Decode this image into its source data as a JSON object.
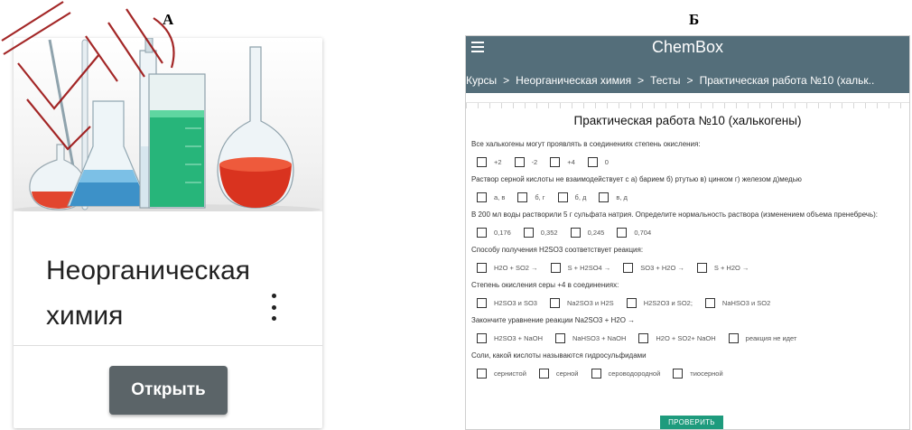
{
  "panel_labels": {
    "a": "А",
    "b": "Б"
  },
  "course_card": {
    "title": "Неорганическая химия",
    "open_button": "Открыть"
  },
  "app": {
    "title": "ChemBox",
    "breadcrumb": [
      "Курсы",
      "Неорганическая химия",
      "Тесты",
      "Практическая работа №10 (хальк.."
    ],
    "breadcrumb_separator": ">",
    "page_title": "Практическая работа №10 (халькогены)",
    "questions": [
      {
        "text": "Все халькогены могут проявлять в соединениях степень окисления:",
        "options": [
          "+2",
          "-2",
          "+4",
          "0"
        ]
      },
      {
        "text": "Раствор серной кислоты не взаимодействует с а) барием б) ртутью в) цинком г) железом д)медью",
        "options": [
          "а, в",
          "б, г",
          "б, д",
          "в, д"
        ]
      },
      {
        "text": "В 200 мл воды растворили 5 г сульфата натрия. Определите нормальность раствора (изменением объема пренебречь):",
        "options": [
          "0,176",
          "0,352",
          "0,245",
          "0,704"
        ]
      },
      {
        "text": "Способу получения H2SO3 соответствует реакция:",
        "options": [
          "H2O + SO2 →",
          "S + H2SO4 →",
          "SO3 + H2O →",
          "S + H2O →"
        ]
      },
      {
        "text": "Степень окисления серы +4 в соединениях:",
        "options": [
          "H2SO3 и SO3",
          "Na2SO3 и H2S",
          "H2S2O3 и SO2;",
          "NaHSO3 и SO2"
        ]
      },
      {
        "text": "Закончите уравнение реакции Na2SO3 + H2O →",
        "options": [
          "H2SO3 + NaOH",
          "NaHSO3 + NaOH",
          "H2O + SO2+ NaOH",
          "реакция не идет"
        ]
      },
      {
        "text": "Соли, какой кислоты называются гидросульфидами",
        "options": [
          "сернистой",
          "серной",
          "сероводородной",
          "тиосерной"
        ]
      }
    ],
    "check_button": "ПРОВЕРИТЬ"
  },
  "colors": {
    "appbar": "#546e7a",
    "check_button": "#1e9b7d",
    "open_button": "#5b6468"
  }
}
